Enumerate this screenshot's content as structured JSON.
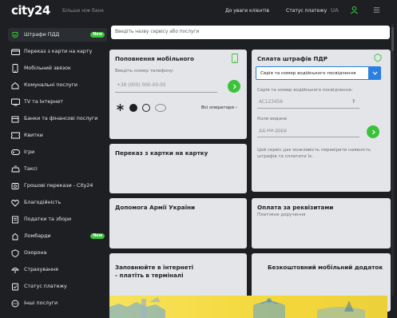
{
  "header": {
    "logo": "city24",
    "tagline": "Більше ніж банк",
    "nav": [
      "До уваги клієнтів",
      "Статус платежу"
    ],
    "lang": "UA"
  },
  "sidebar": {
    "items": [
      {
        "label": "Штрафи ПДД",
        "icon": "car-icon",
        "badge": "New",
        "active": true
      },
      {
        "label": "Переказ з карти на карту",
        "icon": "card-transfer-icon"
      },
      {
        "label": "Мобільний звязок",
        "icon": "phone-icon"
      },
      {
        "label": "Комунальні послуги",
        "icon": "utility-icon"
      },
      {
        "label": "TV та Інтернет",
        "icon": "tv-icon"
      },
      {
        "label": "Банки та фінансові послуги",
        "icon": "bank-icon"
      },
      {
        "label": "Квитки",
        "icon": "ticket-icon"
      },
      {
        "label": "Ігри",
        "icon": "gamepad-icon"
      },
      {
        "label": "Таксі",
        "icon": "taxi-icon"
      },
      {
        "label": "Грошові перекази - City24",
        "icon": "money-transfer-icon"
      },
      {
        "label": "Благодійність",
        "icon": "heart-icon"
      },
      {
        "label": "Податки та збори",
        "icon": "tax-icon"
      },
      {
        "label": "Ломбарди",
        "icon": "pawnshop-icon",
        "badge": "New"
      },
      {
        "label": "Охорона",
        "icon": "shield-icon"
      },
      {
        "label": "Страхування",
        "icon": "insurance-icon"
      },
      {
        "label": "Статус платежу",
        "icon": "status-icon"
      },
      {
        "label": "Інші послуги",
        "icon": "more-icon"
      }
    ]
  },
  "search": {
    "placeholder": "Введіть назву сервісу або послуги"
  },
  "cards": {
    "mobile": {
      "title": "Поповнення мобільного",
      "phone_label": "Введіть номер телефону:",
      "phone_placeholder": "+38 (000) 000-00-00",
      "all_operators": "Всі оператори"
    },
    "fines": {
      "title": "Сплата штрафів ПДР",
      "select_value": "Серія та номер водійського посвідчення",
      "license_label": "Серія та номер водійського посвідчення:",
      "license_placeholder": "AC123456",
      "help": "?",
      "date_label": "Коли видане",
      "date_placeholder": "дд.мм.рррр",
      "note": [
        "Цей сервіс дає можливість перевірити наявність",
        "штрафів та сплатити їх."
      ]
    },
    "card_transfer": {
      "title": "Переказ з картки на картку"
    },
    "army": {
      "title": "Допомога Армії України"
    },
    "requisites": {
      "title": "Оплата за реквізитами",
      "sub": "Платіжне доручення"
    },
    "terminal": {
      "title": [
        "Заповнюйте в інтернеті",
        "- платіть в терміналі"
      ]
    },
    "addon": {
      "title": "Безкоштовний мобільний додаток"
    }
  },
  "colors": {
    "accent": "#3cc13b",
    "select_blue": "#2a7fe0",
    "background": "#1d1f22",
    "card": "#e3e5e8"
  }
}
